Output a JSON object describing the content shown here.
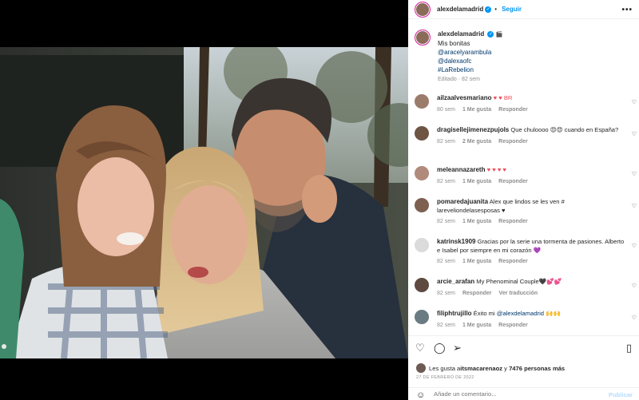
{
  "header": {
    "username": "alexdelamadrid",
    "verified_mark": "✓",
    "separator": "•",
    "follow_label": "Seguir",
    "more_label": "•••"
  },
  "caption": {
    "username": "alexdelamadrid",
    "badge": "🎬",
    "lines": [
      "Mis bonitas",
      "@aracelyarambula",
      "@dalexaofc",
      "#LaRebelion"
    ],
    "edited": "Editado · 82 sem"
  },
  "comments": [
    {
      "user": "ailzaalvesmariano",
      "text": " ♥ ♥ BR",
      "time": "80 sem",
      "likes": "1 Me gusta",
      "reply": "Responder",
      "extra": ""
    },
    {
      "user": "dragisellejimenezpujols",
      "text": " Que chuloooo 😍😍 cuando en España?",
      "time": "82 sem",
      "likes": "2 Me gusta",
      "reply": "Responder",
      "extra": ""
    },
    {
      "user": "meleannazareth",
      "text": " ♥ ♥ ♥ ♥",
      "time": "82 sem",
      "likes": "1 Me gusta",
      "reply": "Responder",
      "extra": ""
    },
    {
      "user": "pomaredajuanita",
      "text": " Alex que lindos se les ven # lareveliondelasesposas ♥",
      "time": "82 sem",
      "likes": "1 Me gusta",
      "reply": "Responder",
      "extra": ""
    },
    {
      "user": "katrinsk1909",
      "text": " Gracias por la serie una tormenta de pasiones. Alberto e Isabel por siempre en mi corazón 💜",
      "time": "82 sem",
      "likes": "1 Me gusta",
      "reply": "Responder",
      "extra": ""
    },
    {
      "user": "arcie_arafan",
      "text": " My Phenominal Couple🖤💕💕",
      "time": "82 sem",
      "likes": "",
      "reply": "Responder",
      "extra": "Ver traducción"
    },
    {
      "user": "filiphtrujillo",
      "text": " Éxito mi ",
      "mention": "@alexdelamadrid",
      "tail": " 🙌🙌",
      "time": "82 sem",
      "likes": "1 Me gusta",
      "reply": "Responder",
      "extra": ""
    }
  ],
  "actions": {
    "like_icon": "heart-outline",
    "comment_icon": "speech-bubble",
    "share_icon": "paper-plane",
    "save_icon": "bookmark",
    "likes_prefix": "Les gusta a ",
    "likes_user": "itsmacarenaoz",
    "likes_mid": " y ",
    "likes_count": "7476 personas más",
    "date": "27 DE FEBRERO DE 2022"
  },
  "add_comment": {
    "placeholder": "Añade un comentario...",
    "publish_label": "Publicar"
  },
  "colors": {
    "accent": "#0095f6",
    "heart": "#ed4956",
    "link": "#00376b",
    "muted": "#8e8e8e"
  }
}
